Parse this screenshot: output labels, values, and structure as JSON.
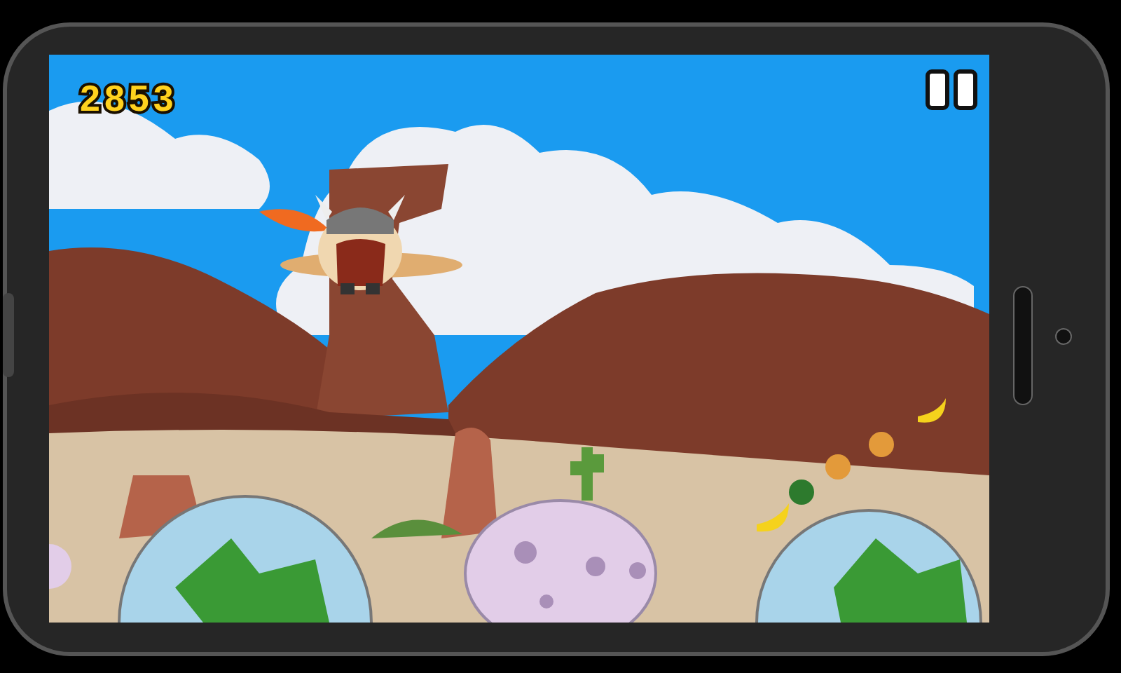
{
  "game": {
    "score": "2853"
  }
}
